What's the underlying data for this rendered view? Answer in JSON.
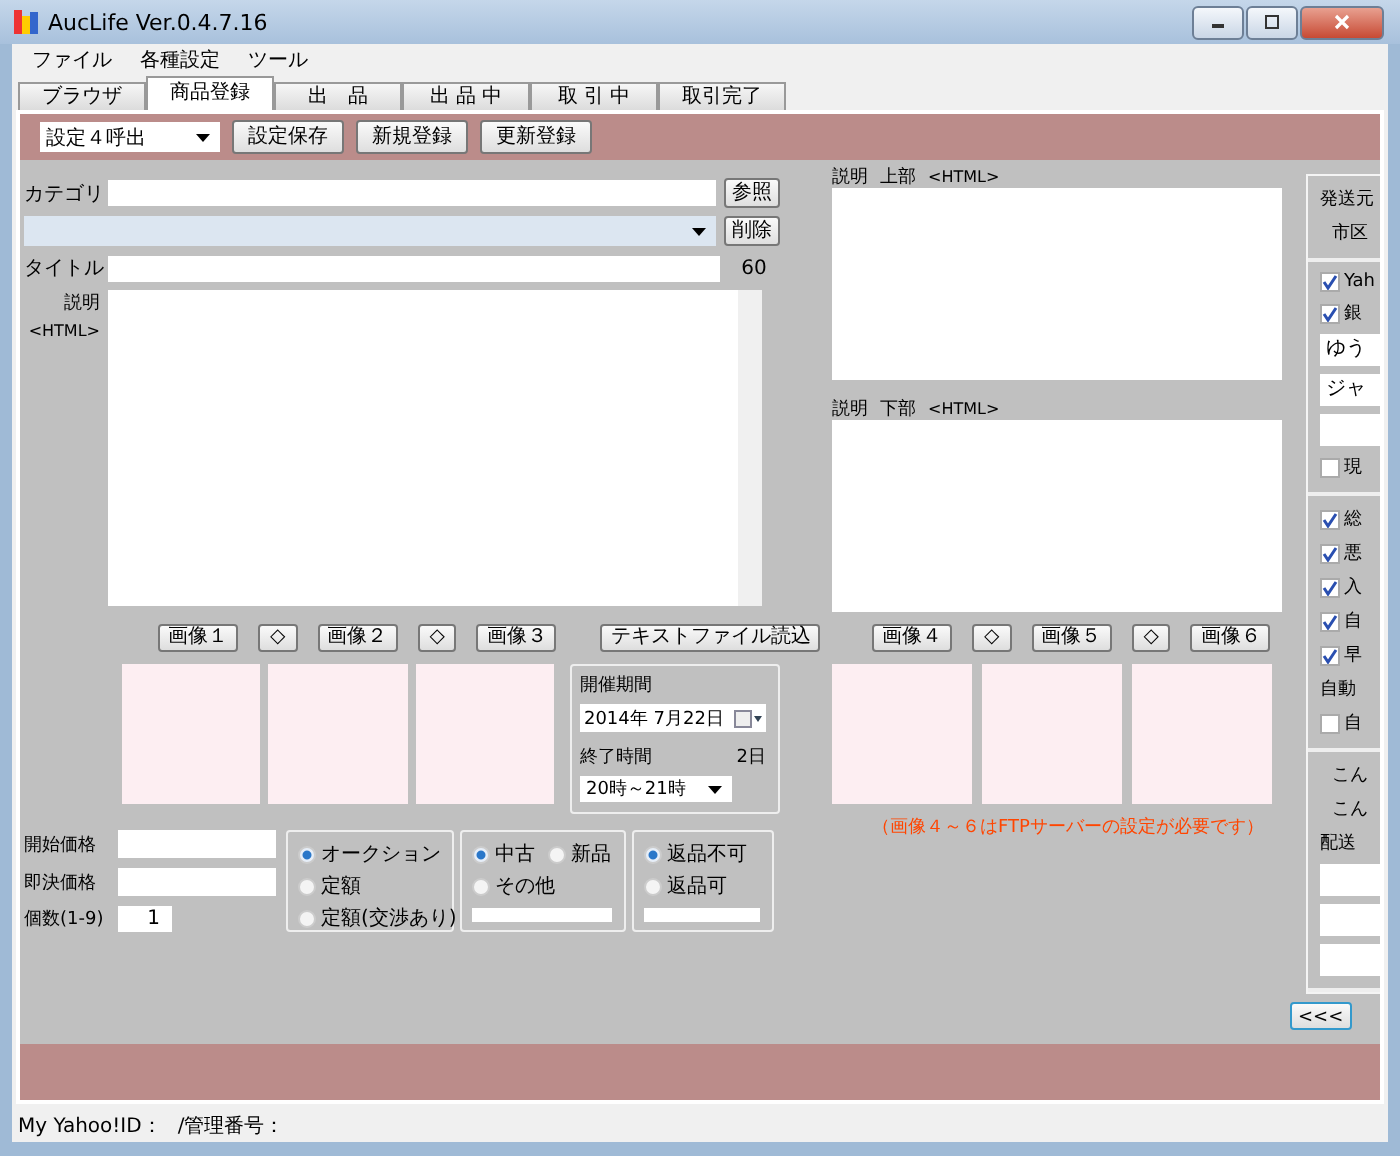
{
  "window": {
    "title": "AucLife Ver.0.4.7.16"
  },
  "menu": [
    "ファイル",
    "各種設定",
    "ツール"
  ],
  "tabs": [
    {
      "label": "ブラウザ",
      "selected": false
    },
    {
      "label": "商品登録",
      "selected": true
    },
    {
      "label": "出　品",
      "selected": false
    },
    {
      "label": "出 品 中",
      "selected": false
    },
    {
      "label": "取 引 中",
      "selected": false
    },
    {
      "label": "取引完了",
      "selected": false
    }
  ],
  "toolbar": {
    "preset": "設定４呼出",
    "buttons": [
      "設定保存",
      "新規登録",
      "更新登録"
    ]
  },
  "form": {
    "category_label": "カテゴリ",
    "browse_button": "参照",
    "delete_button": "削除",
    "title_label": "タイトル",
    "title_limit": "60",
    "description_label": "説明",
    "description_format": "<HTML>",
    "image_buttons": [
      {
        "kind": "image",
        "label": "画像１"
      },
      {
        "kind": "swap",
        "label": "◇"
      },
      {
        "kind": "image",
        "label": "画像２"
      },
      {
        "kind": "swap",
        "label": "◇"
      },
      {
        "kind": "image",
        "label": "画像３"
      }
    ],
    "load_text_button": "テキストファイル読込",
    "period": {
      "label": "開催期間",
      "date": "2014年 7月22日",
      "end_label": "終了時間",
      "days": "2日",
      "end_time": "20時～21時"
    },
    "prices": [
      {
        "label": "開始価格"
      },
      {
        "label": "即決価格"
      },
      {
        "label": "個数(1-9)",
        "value": "1"
      }
    ],
    "option_groups": [
      {
        "options": [
          {
            "label": "オークション",
            "selected": true
          },
          {
            "label": "定額",
            "selected": false
          },
          {
            "label": "定額(交渉あり)",
            "selected": false
          }
        ],
        "field": false
      },
      {
        "options": [
          {
            "label": "中古",
            "selected": true
          },
          {
            "label": "新品",
            "selected": false
          },
          {
            "label": "その他",
            "selected": false
          }
        ],
        "field": true
      },
      {
        "options": [
          {
            "label": "返品不可",
            "selected": true
          },
          {
            "label": "返品可",
            "selected": false
          }
        ],
        "field": true
      }
    ]
  },
  "description_extra": {
    "top_label": "説明",
    "top_part": "上部",
    "top_format": "<HTML>",
    "bottom_label": "説明",
    "bottom_part": "下部",
    "bottom_format": "<HTML>",
    "image_buttons": [
      {
        "kind": "image",
        "label": "画像４"
      },
      {
        "kind": "swap",
        "label": "◇"
      },
      {
        "kind": "image",
        "label": "画像５"
      },
      {
        "kind": "swap",
        "label": "◇"
      },
      {
        "kind": "image",
        "label": "画像６"
      }
    ],
    "note": "（画像４～６はFTPサーバーの設定が必要です）"
  },
  "side_panel": {
    "sections": [
      [
        {
          "kind": "label",
          "text": "発送元"
        },
        {
          "kind": "sublabel",
          "text": "市区"
        }
      ],
      [
        {
          "kind": "check",
          "text": "Yah",
          "checked": true
        },
        {
          "kind": "check",
          "text": "銀",
          "checked": true
        },
        {
          "kind": "field",
          "text": "ゆう"
        },
        {
          "kind": "field",
          "text": "ジャ"
        },
        {
          "kind": "field"
        },
        {
          "kind": "check",
          "text": "現",
          "checked": false
        }
      ],
      [
        {
          "kind": "check",
          "text": "総",
          "checked": true
        },
        {
          "kind": "check",
          "text": "悪",
          "checked": true
        },
        {
          "kind": "check",
          "text": "入",
          "checked": true
        },
        {
          "kind": "check",
          "text": "自",
          "checked": true
        },
        {
          "kind": "check",
          "text": "早",
          "checked": true
        },
        {
          "kind": "label",
          "text": "自動"
        },
        {
          "kind": "check",
          "text": "自",
          "checked": false
        }
      ],
      [
        {
          "kind": "sublabel",
          "text": "こん"
        },
        {
          "kind": "sublabel",
          "text": "こん"
        },
        {
          "kind": "label",
          "text": "配送"
        },
        {
          "kind": "field"
        },
        {
          "kind": "field"
        },
        {
          "kind": "field"
        }
      ]
    ],
    "collapse_button": "<<<"
  },
  "status_bar": [
    "My Yahoo!ID：",
    "/管理番号："
  ]
}
